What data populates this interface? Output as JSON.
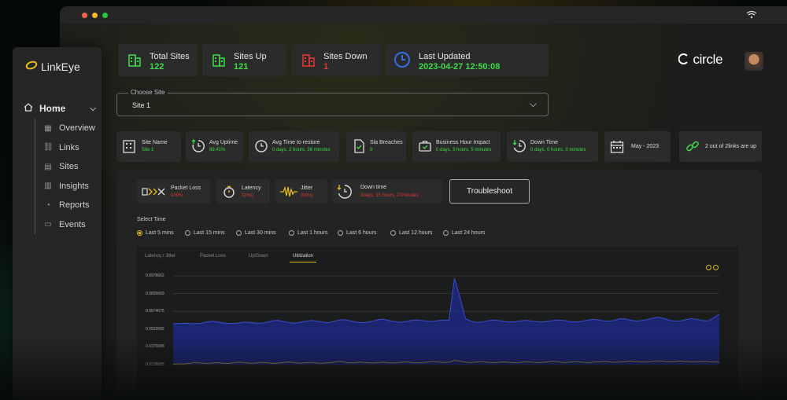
{
  "app": {
    "name": "LinkEye",
    "brand": "circle"
  },
  "sidebar": {
    "home_label": "Home",
    "items": [
      {
        "label": "Overview",
        "icon": "overview-icon"
      },
      {
        "label": "Links",
        "icon": "link-icon"
      },
      {
        "label": "Sites",
        "icon": "sites-icon"
      },
      {
        "label": "Insights",
        "icon": "insights-icon"
      },
      {
        "label": "Reports",
        "icon": "reports-icon"
      },
      {
        "label": "Events",
        "icon": "events-icon"
      }
    ]
  },
  "stats": {
    "total": {
      "label": "Total Sites",
      "value": "122"
    },
    "up": {
      "label": "Sites Up",
      "value": "121"
    },
    "down": {
      "label": "Sites Down",
      "value": "1"
    },
    "updated": {
      "label": "Last Updated",
      "value": "2023-04-27 12:50:08"
    }
  },
  "site_select": {
    "label": "Choose Site",
    "value": "Site 1"
  },
  "metrics": [
    {
      "title": "Site Name",
      "value": "Site 1"
    },
    {
      "title": "Avg Uptime",
      "value": "99.41%"
    },
    {
      "title": "Avg Time to restore",
      "value": "0 days, 2 hours, 36 minutes"
    },
    {
      "title": "Sla Breaches",
      "value": "0"
    },
    {
      "title": "Business Hour Impact",
      "value": "0 days, 3 hours, 5 minutes"
    },
    {
      "title": "Down Time",
      "value": "0 days, 0 hours, 0 minutes"
    },
    {
      "title": "May - 2023",
      "value": ""
    },
    {
      "title": "2 out of 2links are up",
      "value": ""
    }
  ],
  "link_metrics": [
    {
      "title": "Packet Loss",
      "value": "100%"
    },
    {
      "title": "Latency",
      "value": "0(ms)"
    },
    {
      "title": "Jitter",
      "value": "0(ms)"
    },
    {
      "title": "Down time",
      "value": "3days, 15 hours, 27minutes"
    }
  ],
  "troubleshoot_label": "Troubleshoot",
  "select_time": {
    "label": "Select Time",
    "options": [
      "Last 5 mins",
      "Last 15 mins",
      "Last 30 mins",
      "Last 1 hours",
      "Last 6 hours",
      "Last 12 hours",
      "Last 24 hours"
    ],
    "selected": "Last 5 mins"
  },
  "chart_tabs": [
    "Latency / Jitter",
    "Packet Loss",
    "Up/Down",
    "Utilization"
  ],
  "active_chart_tab": "Utilization",
  "colors": {
    "accent": "#e6b820",
    "up": "#3ddc4a",
    "down": "#e53935",
    "updated": "#2f6fe0",
    "series": "#1e2a8c"
  },
  "chart_data": {
    "type": "area",
    "title": "",
    "yticks": [
      "0.0978662",
      "0.0826669",
      "0.0674675",
      "0.0522682",
      "0.0370688",
      "0.0218695"
    ],
    "ylim": [
      0.0218695,
      0.0978662
    ],
    "grid": true,
    "series": [
      {
        "name": "",
        "values": [
          0.0568,
          0.0571,
          0.0574,
          0.057,
          0.0569,
          0.0572,
          0.0583,
          0.059,
          0.0585,
          0.0575,
          0.0572,
          0.0571,
          0.0576,
          0.0584,
          0.058,
          0.0574,
          0.0573,
          0.0582,
          0.0593,
          0.0598,
          0.0588,
          0.0579,
          0.0574,
          0.058,
          0.059,
          0.0596,
          0.0592,
          0.0583,
          0.0578,
          0.0586,
          0.06,
          0.0604,
          0.0595,
          0.0585,
          0.0578,
          0.058,
          0.059,
          0.0602,
          0.0608,
          0.0598,
          0.0588,
          0.0582,
          0.0586,
          0.0596,
          0.0602,
          0.0597,
          0.059,
          0.0588,
          0.0595,
          0.06,
          0.0598,
          0.096,
          0.079,
          0.061,
          0.0592,
          0.058,
          0.0583,
          0.0594,
          0.06,
          0.0596,
          0.0588,
          0.0583,
          0.0586,
          0.0594,
          0.0598,
          0.0592,
          0.0586,
          0.0584,
          0.059,
          0.0597,
          0.06,
          0.0595,
          0.0587,
          0.0584,
          0.0589,
          0.0598,
          0.0606,
          0.0602,
          0.0594,
          0.059,
          0.0598,
          0.0612,
          0.061,
          0.0598,
          0.0592,
          0.0596,
          0.0606,
          0.0618,
          0.0625,
          0.0612,
          0.0598,
          0.0592,
          0.0594,
          0.0604,
          0.0612,
          0.0606,
          0.0596,
          0.0594,
          0.062,
          0.065
        ]
      },
      {
        "name": "",
        "values": [
          0.0222,
          0.0226,
          0.0224,
          0.023,
          0.0238,
          0.0233,
          0.0228,
          0.0232,
          0.0236,
          0.0231,
          0.0229,
          0.0235,
          0.024,
          0.0236,
          0.023,
          0.0233,
          0.0239,
          0.0234,
          0.0229,
          0.0232,
          0.0237,
          0.0242,
          0.0236,
          0.0231,
          0.0234,
          0.0238,
          0.0233,
          0.023,
          0.0235,
          0.0239,
          0.0245,
          0.024,
          0.0233,
          0.0236,
          0.0241,
          0.0236,
          0.0232,
          0.0235,
          0.024,
          0.0236,
          0.0233,
          0.0237,
          0.0242,
          0.0238,
          0.0234,
          0.0236,
          0.024,
          0.0245,
          0.0241,
          0.0237,
          0.0239,
          0.0255,
          0.0248,
          0.024,
          0.0237,
          0.0241,
          0.0244,
          0.0239,
          0.0236,
          0.0238,
          0.0242,
          0.0238,
          0.0235,
          0.0238,
          0.0243,
          0.024,
          0.0236,
          0.0238,
          0.0242,
          0.0246,
          0.0241,
          0.0237,
          0.024,
          0.0244,
          0.024,
          0.0236,
          0.0239,
          0.0243,
          0.0246,
          0.0242,
          0.0238,
          0.0241,
          0.0245,
          0.0249,
          0.0244,
          0.024,
          0.0243,
          0.0247,
          0.0251,
          0.0246,
          0.0242,
          0.0245,
          0.0249,
          0.0245,
          0.0241,
          0.0243,
          0.0247,
          0.0244,
          0.0241,
          0.024
        ]
      }
    ]
  }
}
